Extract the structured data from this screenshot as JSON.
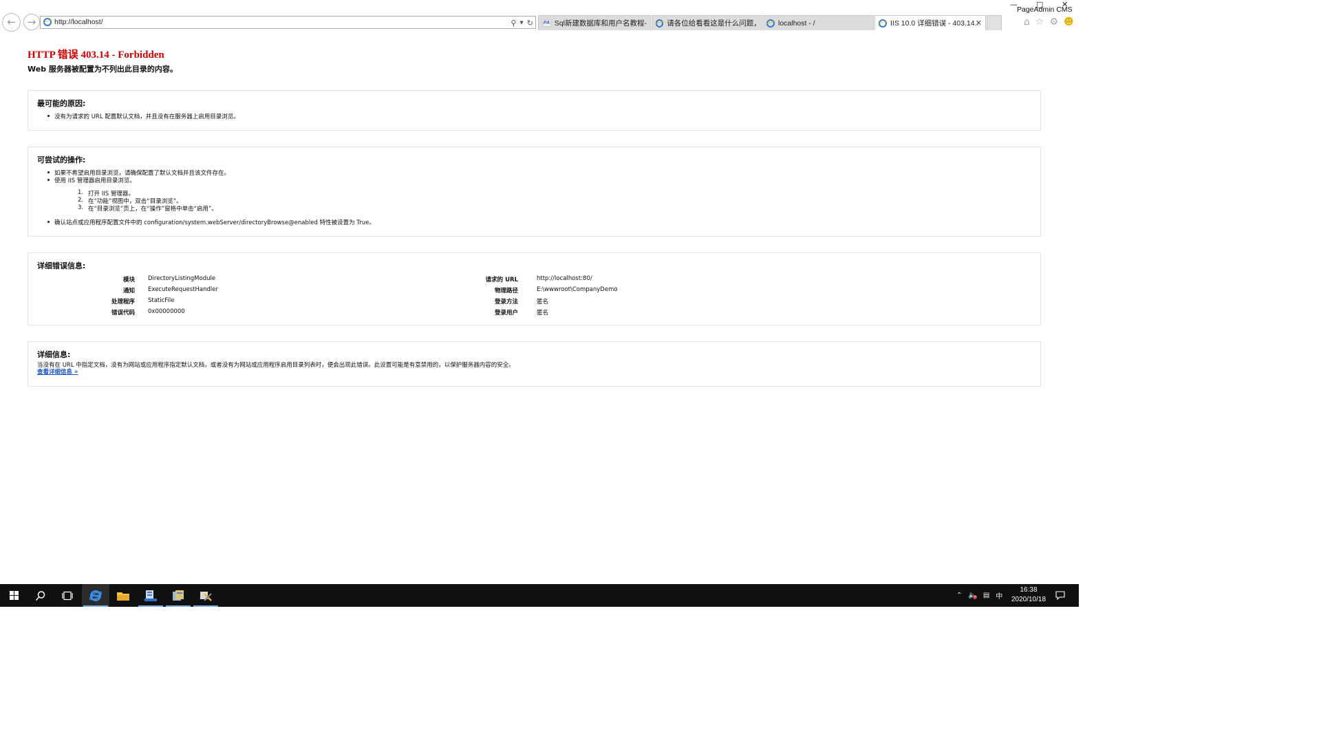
{
  "browser": {
    "window_title": "PageAdmin CMS",
    "address": {
      "url": "http://localhost/"
    },
    "tabs": [
      {
        "label": "Sql新建数据库和用户名教程-P...",
        "icon": "pageadmin-icon",
        "active": false
      },
      {
        "label": "请各位给看看这是什么问题，...",
        "icon": "ie-icon",
        "active": false
      },
      {
        "label": "localhost - /",
        "icon": "ie-icon",
        "active": false
      },
      {
        "label": "IIS 10.0 详细错误 - 403.14...",
        "icon": "ie-icon",
        "active": true
      }
    ],
    "tools": [
      "home-icon",
      "favorites-star-icon",
      "settings-gear-icon",
      "smiley-feedback-icon"
    ]
  },
  "page": {
    "title": "HTTP 错误 403.14 - Forbidden",
    "subtitle": "Web 服务器被配置为不列出此目录的内容。",
    "cause": {
      "heading": "最可能的原因:",
      "items": [
        "没有为请求的 URL 配置默认文档，并且没有在服务器上启用目录浏览。"
      ]
    },
    "actions": {
      "heading": "可尝试的操作:",
      "items": [
        "如果不希望启用目录浏览，请确保配置了默认文档并且该文件存在。",
        "使用 IIS 管理器启用目录浏览。"
      ],
      "steps": [
        "打开 IIS 管理器。",
        "在“功能”视图中，双击“目录浏览”。",
        "在“目录浏览”页上，在“操作”窗格中单击“启用”。"
      ],
      "last_item": "确认站点或应用程序配置文件中的 configuration/system.webServer/directoryBrowse@enabled 特性被设置为 True。"
    },
    "detail_error": {
      "heading": "详细错误信息:",
      "left": [
        {
          "key": "模块",
          "value": "DirectoryListingModule"
        },
        {
          "key": "通知",
          "value": "ExecuteRequestHandler"
        },
        {
          "key": "处理程序",
          "value": "StaticFile"
        },
        {
          "key": "错误代码",
          "value": "0x00000000"
        }
      ],
      "right": [
        {
          "key": "请求的 URL",
          "value": "http://localhost:80/"
        },
        {
          "key": "物理路径",
          "value": "E:\\wwwroot\\CompanyDemo"
        },
        {
          "key": "登录方法",
          "value": "匿名"
        },
        {
          "key": "登录用户",
          "value": "匿名"
        }
      ]
    },
    "more_info": {
      "heading": "详细信息:",
      "text": "当没有在 URL 中指定文档，没有为网站或应用程序指定默认文档，或者没有为网站或应用程序启用目录列表时，便会出现此错误。此设置可能是有意禁用的，以保护服务器内容的安全。",
      "link": "查看详细信息 »"
    }
  },
  "taskbar": {
    "items": [
      "start-icon",
      "search-icon",
      "task-view-icon",
      "internet-explorer-icon",
      "file-explorer-icon",
      "server-manager-icon",
      "app-icon",
      "tools-icon"
    ],
    "tray": {
      "ime": "中"
    },
    "time": "16:38",
    "date": "2020/10/18"
  }
}
